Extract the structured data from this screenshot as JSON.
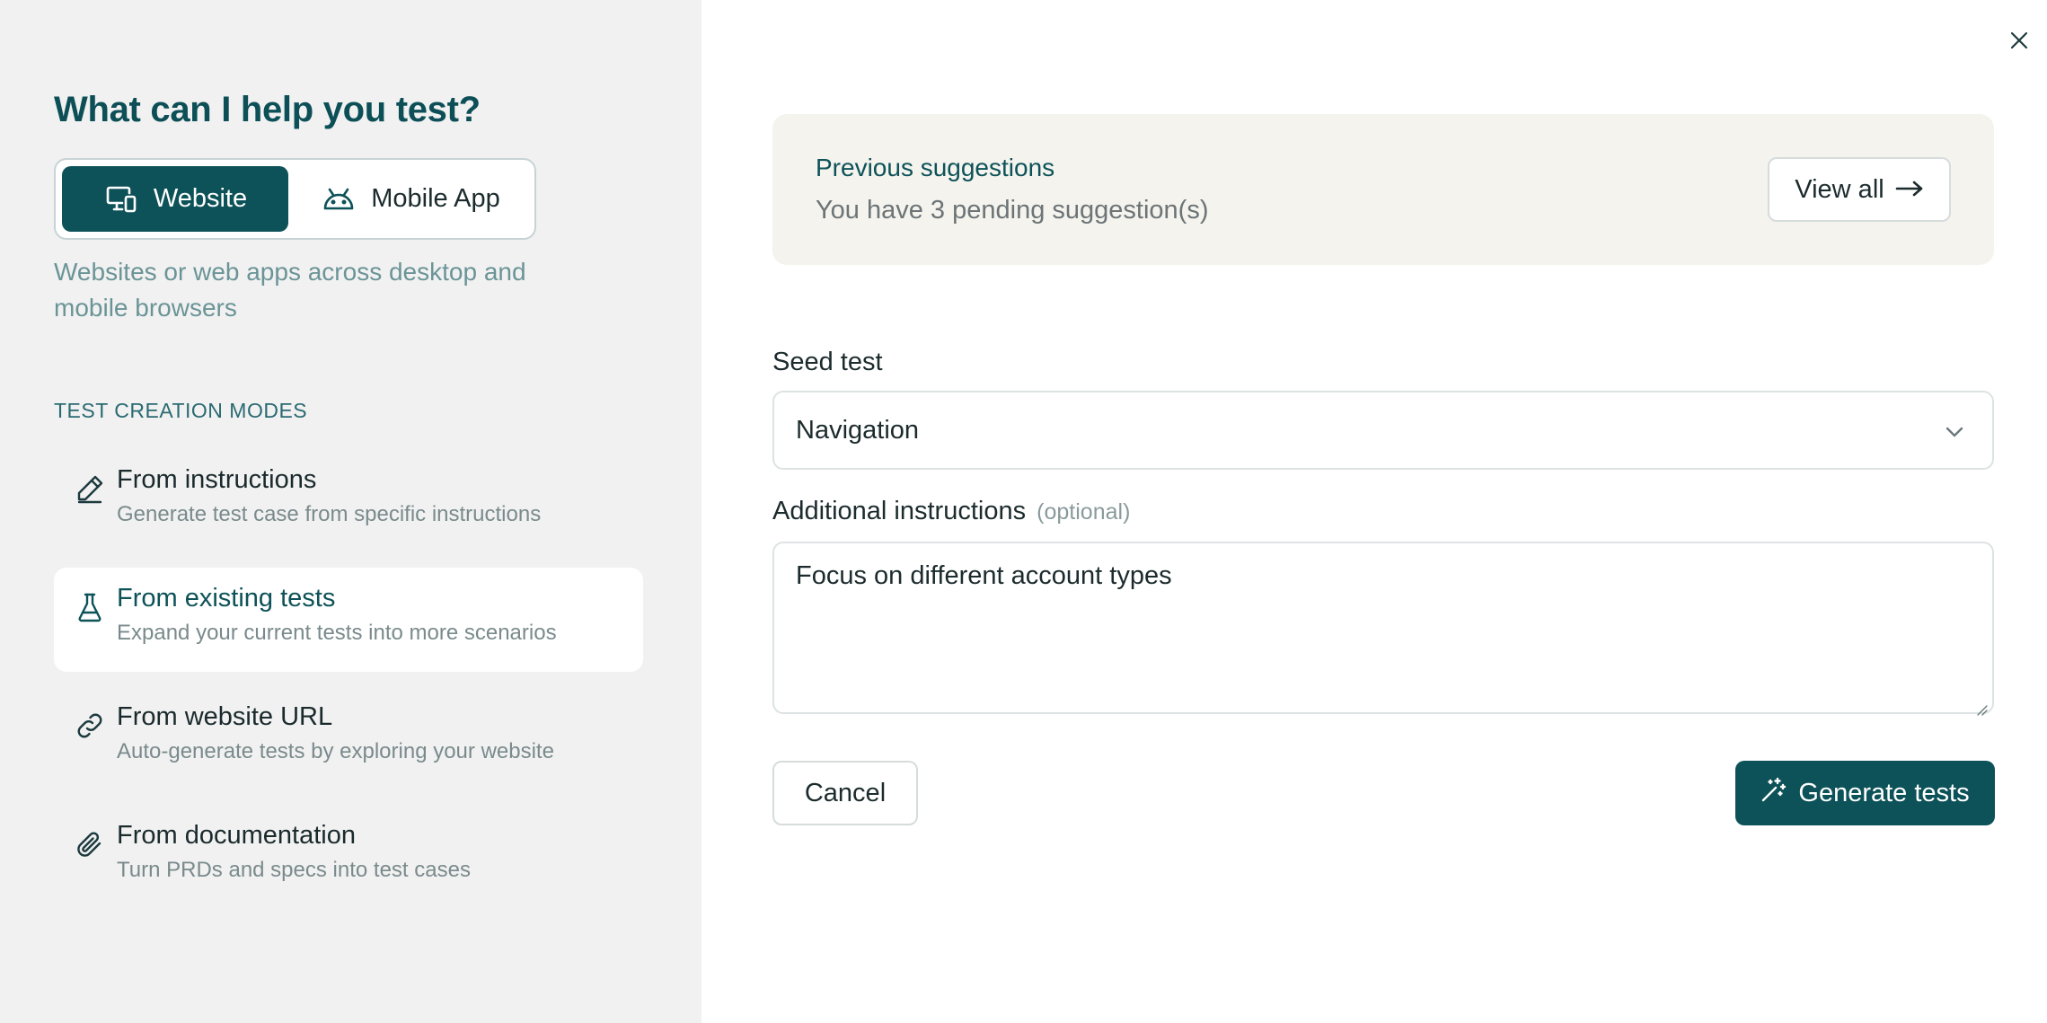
{
  "left": {
    "title": "What can I help you test?",
    "toggle": {
      "website_label": "Website",
      "mobile_label": "Mobile App"
    },
    "description": "Websites or web apps across desktop and mobile browsers",
    "section_label": "TEST CREATION MODES",
    "modes": [
      {
        "title": "From instructions",
        "subtitle": "Generate test case from specific instructions",
        "icon": "pencil-icon"
      },
      {
        "title": "From existing tests",
        "subtitle": "Expand your current tests into more scenarios",
        "icon": "flask-icon",
        "selected": true
      },
      {
        "title": "From website URL",
        "subtitle": "Auto-generate tests by exploring your website",
        "icon": "link-icon"
      },
      {
        "title": "From documentation",
        "subtitle": "Turn PRDs and specs into test cases",
        "icon": "paperclip-icon"
      }
    ]
  },
  "right": {
    "suggestions": {
      "title": "Previous suggestions",
      "subtitle": "You have 3 pending suggestion(s)",
      "view_all_label": "View all"
    },
    "seed_test": {
      "label": "Seed test",
      "value": "Navigation"
    },
    "additional": {
      "label": "Additional instructions",
      "optional_label": "(optional)",
      "value": "Focus on different account types"
    },
    "cancel_label": "Cancel",
    "generate_label": "Generate tests"
  },
  "colors": {
    "brand": "#0d5258",
    "left_bg": "#f1f1f1",
    "suggest_bg": "#f4f3ee"
  }
}
